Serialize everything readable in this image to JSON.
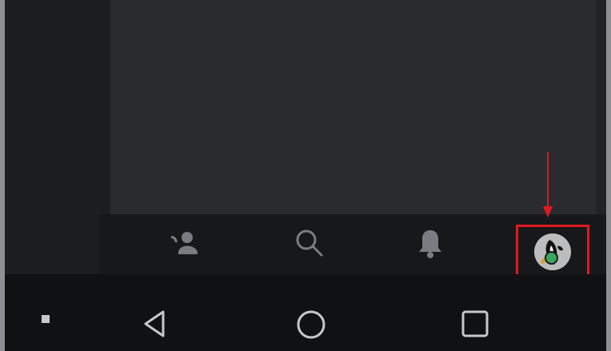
{
  "navigation": {
    "tabs": [
      {
        "icon": "friends-wave-icon",
        "label": ""
      },
      {
        "icon": "search-icon",
        "label": ""
      },
      {
        "icon": "bell-icon",
        "label": ""
      },
      {
        "icon": "avatar-icon",
        "label": ""
      }
    ],
    "profile_highlight_color": "#e2171c",
    "status_color": "#3ba55d"
  },
  "system_bar": {
    "buttons": [
      {
        "icon": "small-square-icon"
      },
      {
        "icon": "back-triangle-icon"
      },
      {
        "icon": "home-circle-icon"
      },
      {
        "icon": "recents-square-icon"
      }
    ]
  }
}
